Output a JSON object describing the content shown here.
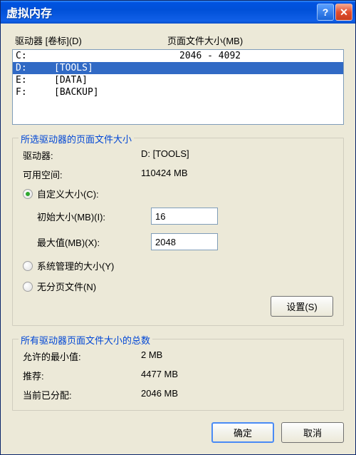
{
  "title": "虚拟内存",
  "header": {
    "drive_label": "驱动器 [卷标](D)",
    "pfsize_label": "页面文件大小(MB)"
  },
  "drives": [
    {
      "letter": "C:",
      "label": "",
      "size": "2046 - 4092",
      "selected": false
    },
    {
      "letter": "D:",
      "label": "[TOOLS]",
      "size": "",
      "selected": true
    },
    {
      "letter": "E:",
      "label": "[DATA]",
      "size": "",
      "selected": false
    },
    {
      "letter": "F:",
      "label": "[BACKUP]",
      "size": "",
      "selected": false
    }
  ],
  "group1": {
    "title": "所选驱动器的页面文件大小",
    "drive_label": "驱动器:",
    "drive_value": "D:   [TOOLS]",
    "space_label": "可用空间:",
    "space_value": "110424 MB",
    "custom_label": "自定义大小(C):",
    "initial_label": "初始大小(MB)(I):",
    "initial_value": "16",
    "max_label": "最大值(MB)(X):",
    "max_value": "2048",
    "system_label": "系统管理的大小(Y)",
    "nopage_label": "无分页文件(N)",
    "set_btn": "设置(S)"
  },
  "group2": {
    "title": "所有驱动器页面文件大小的总数",
    "min_label": "允许的最小值:",
    "min_value": "2 MB",
    "rec_label": "推荐:",
    "rec_value": "4477 MB",
    "cur_label": "当前已分配:",
    "cur_value": "2046 MB"
  },
  "buttons": {
    "ok": "确定",
    "cancel": "取消"
  }
}
